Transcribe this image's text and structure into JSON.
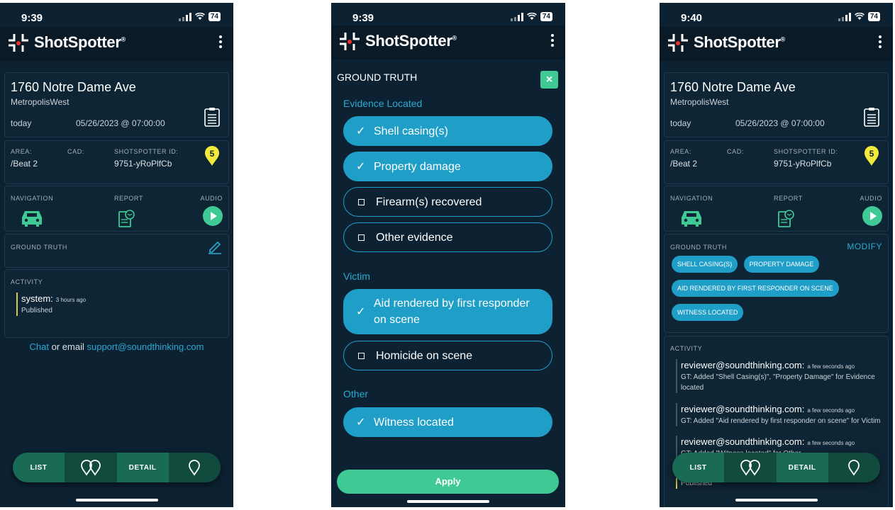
{
  "brand": {
    "name": "ShotSpotter",
    "trademark": "®"
  },
  "status_left": {
    "time": "9:39",
    "battery": "74"
  },
  "status_mid": {
    "time": "9:39",
    "battery": "74"
  },
  "status_right": {
    "time": "9:40",
    "battery": "74"
  },
  "incident": {
    "address": "1760 Notre Dame Ave",
    "district": "MetropolisWest",
    "day": "today",
    "datetime": "05/26/2023 @ 07:00:00",
    "area_label": "AREA:",
    "area_value": "/Beat 2",
    "cad_label": "CAD:",
    "shotspotter_id_label": "SHOTSPOTTER ID:",
    "shotspotter_id_value": "9751-yRoPlfCb",
    "round_count": "5"
  },
  "actions": {
    "navigation": "NAVIGATION",
    "report": "REPORT",
    "audio": "AUDIO"
  },
  "ground_truth": {
    "label": "GROUND TRUTH",
    "modify": "MODIFY",
    "chips": [
      "SHELL CASING(S)",
      "PROPERTY DAMAGE",
      "AID RENDERED BY FIRST RESPONDER ON SCENE",
      "WITNESS LOCATED"
    ]
  },
  "activity": {
    "label": "ACTIVITY",
    "left_entries": [
      {
        "user": "system:",
        "time": "3 hours ago",
        "message": "Published"
      }
    ],
    "right_entries": [
      {
        "user": "reviewer@soundthinking.com:",
        "time": "a few seconds ago",
        "message": "GT: Added \"Shell Casing(s)\", \"Property Damage\" for Evidence located"
      },
      {
        "user": "reviewer@soundthinking.com:",
        "time": "a few seconds ago",
        "message": "GT: Added \"Aid rendered by first responder on scene\" for Victim"
      },
      {
        "user": "reviewer@soundthinking.com:",
        "time": "a few seconds ago",
        "message": "GT: Added \"Witness located\" for Other"
      },
      {
        "user": "",
        "time": "",
        "message": "Published"
      }
    ]
  },
  "contact": {
    "chat": "Chat",
    "or_email": " or email ",
    "email": "support@soundthinking.com"
  },
  "bottom_nav": {
    "list": "LIST",
    "detail": "DETAIL"
  },
  "gt_modal": {
    "title": "GROUND TRUTH",
    "close": "×",
    "sections": [
      {
        "title": "Evidence Located",
        "options": [
          {
            "label": "Shell casing(s)",
            "checked": true
          },
          {
            "label": "Property damage",
            "checked": true
          },
          {
            "label": "Firearm(s) recovered",
            "checked": false
          },
          {
            "label": "Other evidence",
            "checked": false
          }
        ]
      },
      {
        "title": "Victim",
        "options": [
          {
            "label": "Aid rendered by first responder on scene",
            "checked": true
          },
          {
            "label": "Homicide on scene",
            "checked": false
          }
        ]
      },
      {
        "title": "Other",
        "options": [
          {
            "label": "Witness located",
            "checked": true
          }
        ]
      }
    ],
    "apply": "Apply"
  },
  "colors": {
    "background": "#0c2232",
    "accent_green": "#3ec995",
    "accent_blue": "#1f9ec8",
    "pin_yellow": "#f3e93a"
  }
}
